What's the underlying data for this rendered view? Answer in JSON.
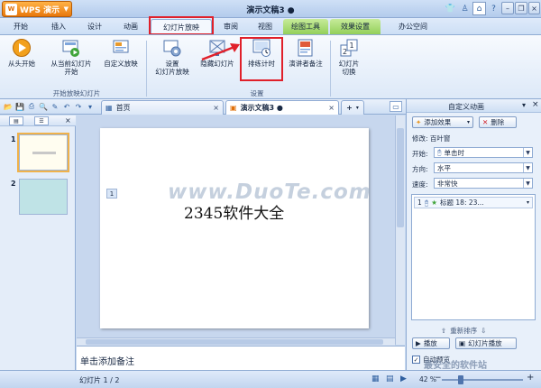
{
  "app": {
    "name": "WPS 演示",
    "logo_glyph": "W",
    "document_title": "演示文稿3 ●",
    "accent": "#f0901c",
    "highlight_color": "#e0202a"
  },
  "menu": {
    "tabs": [
      {
        "label": "开始"
      },
      {
        "label": "插入"
      },
      {
        "label": "设计"
      },
      {
        "label": "动画"
      },
      {
        "label": "幻灯片放映",
        "active": true
      },
      {
        "label": "审阅"
      },
      {
        "label": "视图"
      },
      {
        "label": "绘图工具",
        "context": true
      },
      {
        "label": "效果设置",
        "context": true
      },
      {
        "label": "办公空间"
      }
    ]
  },
  "ribbon": {
    "buttons": [
      {
        "label": "从头开始",
        "icon": "play-icon"
      },
      {
        "label": "从当前幻灯片\n开始",
        "icon": "play-current-icon"
      },
      {
        "label": "自定义放映",
        "icon": "custom-show-icon"
      },
      {
        "label": "设置\n幻灯片放映",
        "icon": "setup-show-icon"
      },
      {
        "label": "隐藏幻灯片",
        "icon": "hide-slide-icon"
      },
      {
        "label": "排练计时",
        "icon": "rehearse-timing-icon"
      },
      {
        "label": "演讲者备注",
        "icon": "speaker-notes-icon"
      },
      {
        "label": "幻灯片\n切换",
        "icon": "slide-transition-icon"
      }
    ],
    "groups": [
      {
        "label": "开始放映幻灯片"
      },
      {
        "label": "设置"
      }
    ]
  },
  "docbar": {
    "tabs": [
      {
        "label": "首页",
        "icon": "home-icon"
      },
      {
        "label": "演示文稿3 ●",
        "icon": "presentation-icon",
        "active": true
      }
    ],
    "new_tab_label": "+"
  },
  "thumbnails": {
    "slides": [
      {
        "number": "1",
        "selected": true
      },
      {
        "number": "2"
      }
    ]
  },
  "slide": {
    "placeholder_number": "1",
    "text": "2345软件大全",
    "watermark": "www.DuoTe.com"
  },
  "notes": {
    "placeholder": "单击添加备注"
  },
  "pane": {
    "title": "自定义动画",
    "add_effect_label": "添加效果",
    "delete_label": "删除",
    "modify_label": "修改: 百叶窗",
    "start_label": "开始:",
    "start_value": "单击时",
    "direction_label": "方向:",
    "direction_value": "水平",
    "speed_label": "速度:",
    "speed_value": "非常快",
    "anim_item": {
      "index": "1",
      "label": "标题 18: 23..."
    },
    "reorder_label": "重新排序",
    "play_label": "播放",
    "slideshow_label": "幻灯片播放",
    "autopreview_label": "自动预览"
  },
  "status": {
    "slide_counter": "幻灯片 1 / 2",
    "zoom": "42 %",
    "zoom_value": 0.42,
    "site_watermark": "最安全的软件站"
  }
}
